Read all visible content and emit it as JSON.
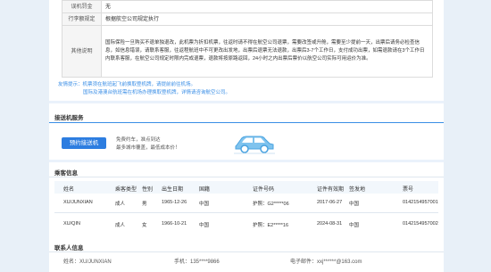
{
  "info": {
    "rows": [
      {
        "label": "误机罚金",
        "value": "无"
      },
      {
        "label": "行李额规定",
        "value": "根据航空公司规定执行"
      },
      {
        "label": "其他说明",
        "value": "国际保险一旦购买不退单独退改，此机票为折扣机票，往返时请不得在航空公司退票，需要改签或升舱，需要至少提前一天，出票后请务必检查信息，如信息错误，请联系客服，往返程航班中不可更改出发地，出票后退票无法退款，出票后3-7个工作日，支付成功出票，如需退款请在3个工作日内联系客服，在航空公司规定时限内完成退票，退款将按原路返回，24小时之内出票后票价以航空公司实际可用运价为准。"
      }
    ]
  },
  "notes": {
    "line1": "友情提示：机票须在航班起飞前换取登机牌，请提前前往机场。",
    "line2": "国际及港澳台航班需在机场办理换取登机牌，详情请咨询航空公司。"
  },
  "pickup": {
    "title": "接送机服务",
    "button": "预约接送机",
    "line1": "免费约车，准点到达",
    "line2": "最多城市覆盖，最低成本价！"
  },
  "passengers": {
    "title": "乘客信息",
    "headers": [
      "姓名",
      "乘客类型",
      "性别",
      "出生日期",
      "国籍",
      "证件号码",
      "证件有效期",
      "签发地",
      "票号"
    ],
    "rows": [
      [
        "XU/JUNXIAN",
        "成人",
        "男",
        "1965-12-26",
        "中国",
        "护照：G2*****06",
        "2017-06-27",
        "中国",
        "0142154957001"
      ],
      [
        "XU/QIN",
        "成人",
        "女",
        "1966-10-21",
        "中国",
        "护照：E2*****16",
        "2024-08-31",
        "中国",
        "0142154957002"
      ]
    ]
  },
  "contact": {
    "title": "联系人信息",
    "name": "姓名：XU/JUNXIAN",
    "phone": "手机：135****9866",
    "email": "电子邮件：xxj******@163.com"
  },
  "colors": {
    "accent": "#2d7de0",
    "link": "#3a8ee6",
    "band": "#eaf2fb"
  }
}
